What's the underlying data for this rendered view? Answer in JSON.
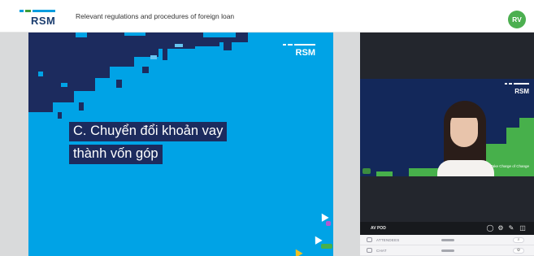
{
  "header": {
    "logo_text": "RSM",
    "title": "Relevant regulations and procedures of foreign loan",
    "avatar_initials": "RV"
  },
  "slide": {
    "logo_text": "RSM",
    "caption_line1": "C. Chuyển đổi khoản vay",
    "caption_line2": "thành vốn góp",
    "colors": {
      "background": "#00a3e6",
      "dark_blocks": "#1c2b5e"
    }
  },
  "video": {
    "logo_text": "RSM",
    "tagline": "Take Charge of Change"
  },
  "toolbar": {
    "label": "AV POD",
    "icons": [
      "chat-bubbles-icon",
      "gear-icon",
      "edit-icon",
      "exit-icon"
    ]
  },
  "rows": [
    {
      "label": "ATTENDEES",
      "icon": "people-icon",
      "button_glyph": "⌕"
    },
    {
      "label": "CHAT",
      "icon": "chat-icon",
      "button_glyph": "⚙"
    }
  ],
  "colors": {
    "accent_green": "#47b04b",
    "brand_navy": "#1c2b5e",
    "avatar_green": "#4caf50"
  }
}
